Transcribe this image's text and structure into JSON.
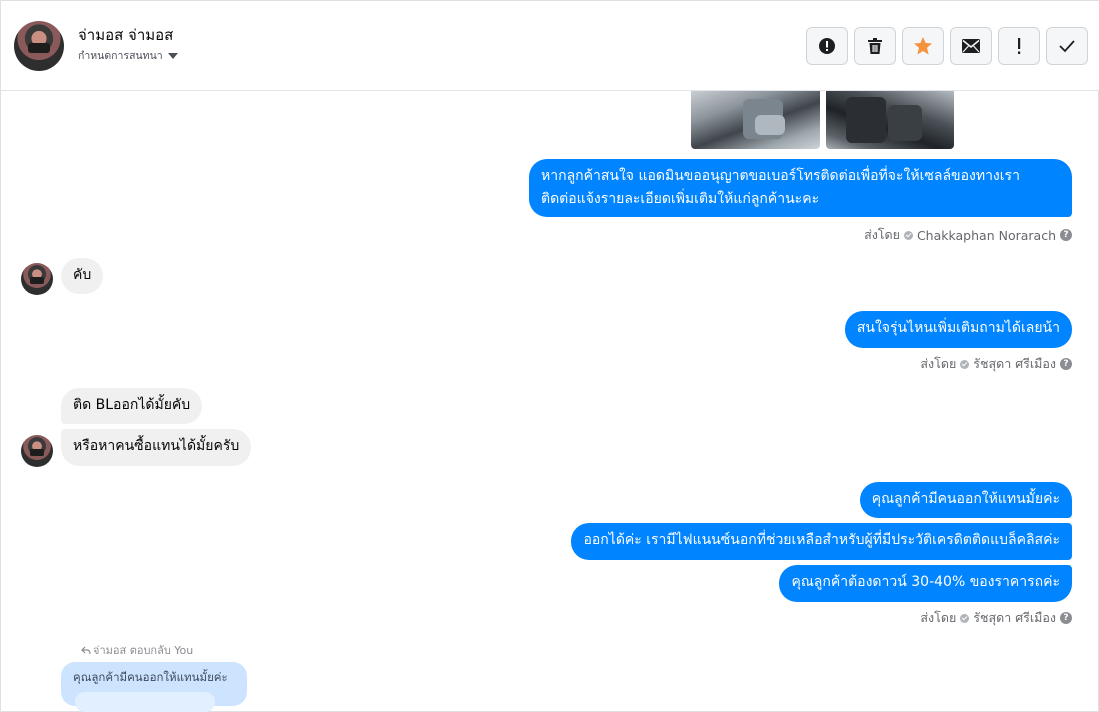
{
  "header": {
    "contact_name": "จ่ามอส จ่ามอส",
    "conversation_label": "กำหนดการสนทนา",
    "toolbar": [
      {
        "name": "report-spam-icon",
        "label": "Report"
      },
      {
        "name": "trash-icon",
        "label": "Delete"
      },
      {
        "name": "star-icon",
        "label": "Star"
      },
      {
        "name": "envelope-icon",
        "label": "Mark unread"
      },
      {
        "name": "exclamation-icon",
        "label": "!"
      },
      {
        "name": "checkmark-icon",
        "label": "Done"
      }
    ],
    "colors": {
      "star": "#f5923e",
      "accent": "#0084ff"
    }
  },
  "thread": {
    "messages": [
      {
        "type": "out",
        "lines": [
          "หากลูกค้าสนใจ แอดมินขออนุญาตขอเบอร์โทรติดต่อเพื่อที่จะให้เซลล์ของทางเรา",
          "ติดต่อแจ้งรายละเอียดเพิ่มเติมให้แก่ลูกค้านะคะ"
        ]
      },
      {
        "type": "meta",
        "sent_by_label": "ส่งโดย",
        "sender": "Chakkaphan Norarach"
      },
      {
        "type": "in",
        "text": "คับ"
      },
      {
        "type": "out",
        "text": "สนใจรุ่นไหนเพิ่มเติมถามได้เลยน้า"
      },
      {
        "type": "meta",
        "sent_by_label": "ส่งโดย",
        "sender": "รัชสุดา ศรีเมือง"
      },
      {
        "type": "in",
        "text": "ติด BLออกได้มั้ยคับ"
      },
      {
        "type": "in",
        "text": "หรือหาคนซื้อแทนได้มั้ยครับ"
      },
      {
        "type": "out",
        "text": "คุณลูกค้ามีคนออกให้แทนมั้ยค่ะ"
      },
      {
        "type": "out",
        "text": "ออกได้ค่ะ เรามีไฟแนนซ์นอกที่ช่วยเหลือสำหรับผู้ที่มีประวัติเครดิตติดแบล็คลิสค่ะ"
      },
      {
        "type": "out",
        "text": "คุณลูกค้าต้องดาวน์ 30-40% ของราคารถค่ะ"
      },
      {
        "type": "meta",
        "sent_by_label": "ส่งโดย",
        "sender": "รัชสุดา ศรีเมือง"
      }
    ],
    "reply": {
      "tag": "จ่ามอส ตอบกลับ You",
      "quoted": "คุณลูกค้ามีคนออกให้แทนมั้ยค่ะ"
    }
  }
}
